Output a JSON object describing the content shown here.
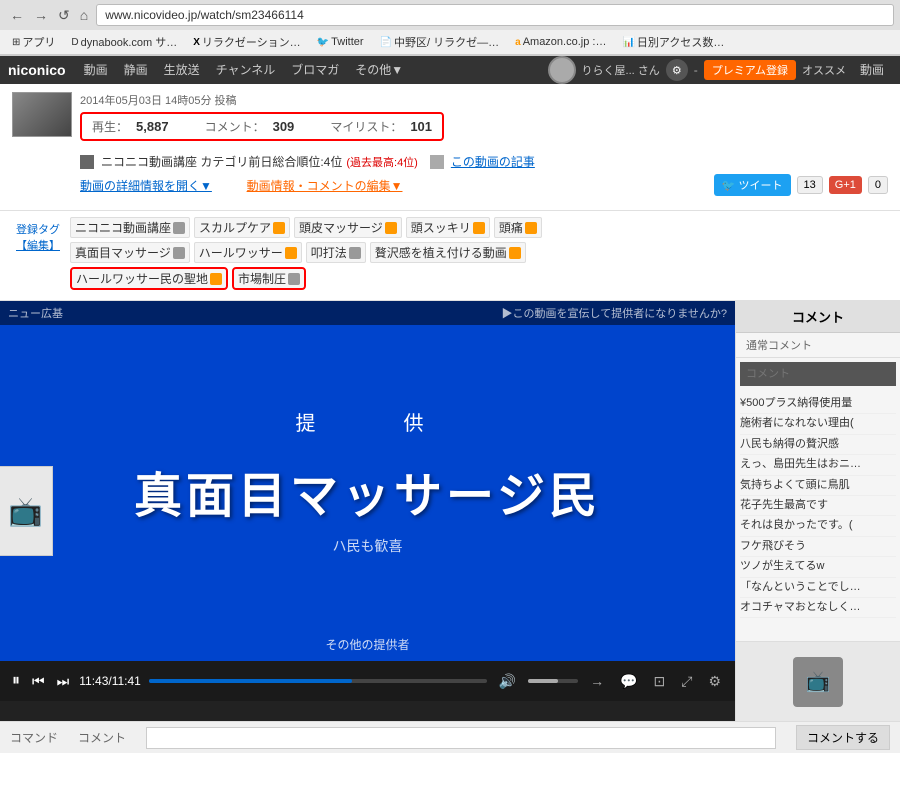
{
  "browser": {
    "back_btn": "←",
    "forward_btn": "→",
    "reload_btn": "↺",
    "home_btn": "⌂",
    "url": "www.nicovideo.jp/watch/sm23466114"
  },
  "bookmarks": [
    {
      "label": "アプリ",
      "icon": "☰"
    },
    {
      "label": "dynabook.com サ…",
      "icon": "D"
    },
    {
      "label": "リラクゼーション…",
      "icon": "X"
    },
    {
      "label": "Twitter",
      "icon": "🐦"
    },
    {
      "label": "中野区/ リラクゼ—…",
      "icon": "📄"
    },
    {
      "label": "Amazon.co.jp :…",
      "icon": "a"
    },
    {
      "label": "日別アクセス数…",
      "icon": "📊"
    }
  ],
  "site_nav": {
    "logo": "niconico",
    "items": [
      "動画",
      "静画",
      "生放送",
      "チャンネル",
      "ブロマガ",
      "その他▼"
    ],
    "user": "りらく屋... さん",
    "premium": "プレミアム登録",
    "osusume": "オススメ",
    "video_nav": "動画"
  },
  "video_info": {
    "post_date": "2014年05月03日 14時05分 投稿",
    "stats": {
      "play_label": "再生：",
      "play_count": "5,887",
      "comment_label": "コメント：",
      "comment_count": "309",
      "mylist_label": "マイリスト：",
      "mylist_count": "101"
    },
    "category": "ニコニコ動画講座 カテゴリ前日総合順位:4位",
    "rank_past": "(過去最高:4位)",
    "article_link": "この動画の記事",
    "details_link": "動画の詳細情報を開く▼",
    "comment_edit_link": "動画情報・コメントの編集▼",
    "tweet_btn": "ツイート",
    "tweet_count": "13",
    "gplus_btn": "G+1",
    "gplus_count": "0"
  },
  "tags": {
    "register_label": "登録タグ",
    "edit_label": "【編集】",
    "items": [
      {
        "text": "ニコニコ動画講座",
        "special": false
      },
      {
        "text": "スカルプケア",
        "special": false
      },
      {
        "text": "頭皮マッサージ",
        "special": false
      },
      {
        "text": "頭スッキリ",
        "special": false
      },
      {
        "text": "頭痛",
        "special": false
      },
      {
        "text": "真面目マッサージ",
        "special": false
      },
      {
        "text": "ハールワッサー",
        "special": false
      },
      {
        "text": "叩打法",
        "special": false
      },
      {
        "text": "贅沢感を植え付ける動画",
        "special": false
      },
      {
        "text": "ハールワッサー民の聖地",
        "special": true,
        "highlighted": true
      },
      {
        "text": "市場制圧",
        "special": true,
        "highlighted": true
      }
    ]
  },
  "video": {
    "watermark": "ニュー広基",
    "ad_text": "▶この動画を宣伝して提供者になりませんか?",
    "providing_label": "提　　供",
    "main_title": "真面目マッサージ民",
    "subtitle": "ハ民も歓喜",
    "provider_label": "その他の提供者",
    "time_current": "11:43",
    "time_total": "11:41"
  },
  "comments_panel": {
    "header": "コメント",
    "type_label": "通常コメント",
    "input_placeholder": "コメント",
    "items": [
      "¥500プラス納得使用量",
      "施術者になれない理由(",
      "八民も納得の贅沢感",
      "えっ、島田先生はおニ…",
      "気持ちよくて頭に鳥肌",
      "花子先生最高です",
      "それは良かったです。(",
      "フケ飛びそう",
      "ツノが生えてるw",
      "「なんということでし…",
      "オコチャマおとなしく…"
    ]
  },
  "bottom_bar": {
    "command_label": "コマンド",
    "comment_label": "コメント",
    "submit_btn": "コメントする"
  },
  "colors": {
    "accent_red": "#cc0000",
    "link_blue": "#0066cc",
    "nav_bg": "#333333",
    "video_bg": "#0044cc",
    "twitter_blue": "#1da1f2"
  }
}
